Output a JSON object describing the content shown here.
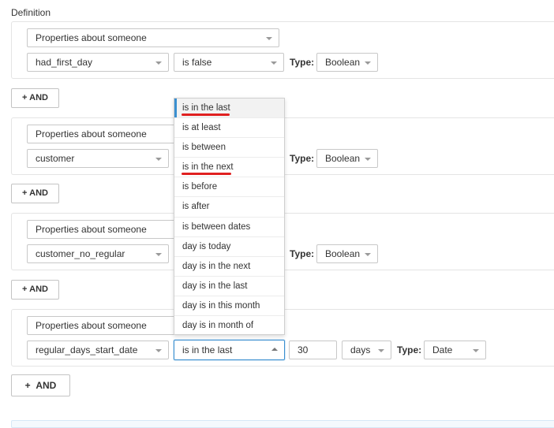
{
  "section_title": "Definition",
  "and_label": "+ AND",
  "type_label": "Type:",
  "conditions": [
    {
      "category": "Properties about someone",
      "property": "had_first_day",
      "operator": "is false",
      "type": "Boolean"
    },
    {
      "category": "Properties about someone",
      "property": "customer",
      "operator": "",
      "type": "Boolean"
    },
    {
      "category": "Properties about someone",
      "property": "customer_no_regular",
      "operator": "",
      "type": "Boolean"
    },
    {
      "category": "Properties about someone",
      "property": "regular_days_start_date",
      "operator": "is in the last",
      "amount": "30",
      "unit": "days",
      "type": "Date"
    }
  ],
  "operator_dropdown": {
    "options": [
      "is in the last",
      "is at least",
      "is between",
      "is in the next",
      "is before",
      "is after",
      "is between dates",
      "day is today",
      "day is in the next",
      "day is in the last",
      "day is in this month",
      "day is in month of"
    ],
    "selected": "is in the last",
    "annotated_options": [
      "is in the last",
      "is in the next"
    ],
    "annotation_color": "#e02020",
    "accent_color": "#3a8fd0"
  },
  "footer_button": {
    "plus": "+",
    "label": "AND"
  }
}
